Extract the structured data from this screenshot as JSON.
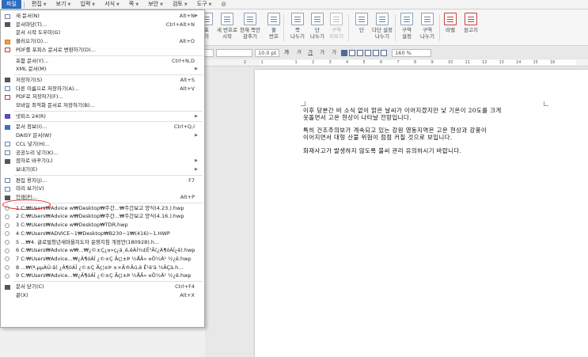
{
  "menubar": {
    "items": [
      {
        "label": "파일",
        "active": true,
        "arrow": false
      },
      {
        "label": "편집",
        "active": false,
        "arrow": true
      },
      {
        "label": "보기",
        "active": false,
        "arrow": true
      },
      {
        "label": "입력",
        "active": false,
        "arrow": true
      },
      {
        "label": "서식",
        "active": false,
        "arrow": true
      },
      {
        "label": "쪽",
        "active": false,
        "arrow": true
      },
      {
        "label": "보안",
        "active": false,
        "arrow": true
      },
      {
        "label": "검토",
        "active": false,
        "arrow": true
      },
      {
        "label": "도구",
        "active": false,
        "arrow": true
      }
    ]
  },
  "ribbon": {
    "buttons": [
      {
        "l1": "포",
        "l2": "기",
        "icon": "border-icon"
      },
      {
        "l1": "새 번호로",
        "l2": "시작",
        "icon": "page-number-new-icon"
      },
      {
        "l1": "현재 쪽만",
        "l2": "감추기",
        "icon": "hide-current-page-icon"
      },
      {
        "l1": "줄",
        "l2": "번호",
        "icon": "line-number-icon"
      },
      {
        "l1": "쪽",
        "l2": "나누기",
        "icon": "page-break-icon"
      },
      {
        "l1": "단",
        "l2": "나누기",
        "icon": "column-break-icon"
      },
      {
        "l1": "구역",
        "l2": "지우기",
        "icon": "delete-section-icon",
        "disabled": true
      },
      {
        "l1": "단",
        "l2": "",
        "icon": "columns-icon"
      },
      {
        "l1": "다단 설정",
        "l2": "나누기",
        "icon": "multi-column-icon"
      },
      {
        "l1": "구역",
        "l2": "설정",
        "icon": "section-settings-icon"
      },
      {
        "l1": "구역",
        "l2": "나누기",
        "icon": "section-break-icon"
      },
      {
        "l1": "라벨",
        "l2": "",
        "icon": "label-icon"
      },
      {
        "l1": "원고지",
        "l2": "",
        "icon": "manuscript-paper-icon"
      }
    ]
  },
  "format": {
    "font_size": "10.0",
    "unit": "pt",
    "zoom": "160",
    "zoom_unit": "%"
  },
  "ruler": {
    "ticks": [
      "2",
      "1",
      "",
      "1",
      "2",
      "3",
      "4",
      "5",
      "6",
      "7",
      "8",
      "9",
      "10",
      "11",
      "12",
      "13",
      "14",
      "15",
      "16"
    ]
  },
  "document": {
    "paragraphs": [
      "이후 당분간 비 소식 없이 맑은 날씨가 이어지겠지만 낮 기온이 20도를 크게\n웃돌면서 고온 현상이 나타날 전망입니다.",
      "특히 건조주의보가 계속되고 있는 강원 영동지역은 고온 현상과 강풍이\n이어지면서 대형 산불 위험이 점점 커질 것으로 보입니다.",
      "화재사고가 발생하지 않도록 불씨 관리 유의하시기 바랍니다."
    ]
  },
  "file_menu": {
    "items": [
      {
        "label": "새 문서(N)",
        "shortcut": "Alt+N",
        "submenu": true,
        "icon": "new-doc-icon",
        "icon_class": ""
      },
      {
        "label": "문서마당(T)...",
        "shortcut": "Ctrl+Alt+N",
        "submenu": false,
        "icon": "template-icon",
        "icon_class": "dark"
      },
      {
        "label": "문서 시작 도우미(G)",
        "shortcut": "",
        "submenu": false,
        "icon": "",
        "icon_class": "none"
      },
      {
        "label": "불러오기(O)...",
        "shortcut": "Alt+O",
        "submenu": false,
        "icon": "open-folder-icon",
        "icon_class": "orange"
      },
      {
        "label": "PDF를 포피스 문서로 변환하기(D)...",
        "shortcut": "",
        "submenu": false,
        "icon": "pdf-convert-icon",
        "icon_class": "red"
      },
      {
        "sep": true
      },
      {
        "label": "포함 문서(Y)...",
        "shortcut": "Ctrl+N,D",
        "submenu": false,
        "icon": "",
        "icon_class": "none"
      },
      {
        "label": "XML 문서(M)",
        "shortcut": "",
        "submenu": true,
        "icon": "",
        "icon_class": "none"
      },
      {
        "sep": true
      },
      {
        "label": "저장하기(S)",
        "shortcut": "Alt+S",
        "submenu": false,
        "icon": "save-icon",
        "icon_class": "dark"
      },
      {
        "label": "다른 이름으로 저장하기(A)...",
        "shortcut": "Alt+V",
        "submenu": false,
        "icon": "save-as-icon",
        "icon_class": ""
      },
      {
        "label": "PDF로 저장하기(F)...",
        "shortcut": "",
        "submenu": false,
        "icon": "pdf-save-icon",
        "icon_class": "red"
      },
      {
        "label": "모바일 최적화 문서로 저장하기(B)...",
        "shortcut": "",
        "submenu": false,
        "icon": "",
        "icon_class": "none"
      },
      {
        "sep": true
      },
      {
        "label": "넷피스 24(R)",
        "shortcut": "",
        "submenu": true,
        "icon": "netffice-icon",
        "icon_class": "purple"
      },
      {
        "sep": true
      },
      {
        "label": "문서 정보(I)...",
        "shortcut": "Ctrl+Q,I",
        "submenu": false,
        "icon": "doc-info-icon",
        "icon_class": "blue"
      },
      {
        "label": "DAISY 문서(W)",
        "shortcut": "",
        "submenu": true,
        "icon": "",
        "icon_class": "none"
      },
      {
        "label": "CCL 넣기(H)...",
        "shortcut": "",
        "submenu": false,
        "icon": "ccl-icon",
        "icon_class": ""
      },
      {
        "label": "공공누리 넣기(K)...",
        "shortcut": "",
        "submenu": false,
        "icon": "kogl-icon",
        "icon_class": ""
      },
      {
        "label": "점자로 바꾸기(L)",
        "shortcut": "",
        "submenu": true,
        "icon": "braille-icon",
        "icon_class": "dark"
      },
      {
        "label": "보내기(E)",
        "shortcut": "",
        "submenu": true,
        "icon": "",
        "icon_class": "none"
      },
      {
        "sep": true
      },
      {
        "label": "편집 용지(J)...",
        "shortcut": "F7",
        "submenu": false,
        "icon": "page-setup-icon",
        "icon_class": ""
      },
      {
        "label": "미리 보기(V)",
        "shortcut": "",
        "submenu": false,
        "icon": "print-preview-icon",
        "icon_class": ""
      },
      {
        "label": "인쇄(P)...",
        "shortcut": "Alt+P",
        "submenu": false,
        "icon": "print-icon",
        "icon_class": "dark"
      },
      {
        "sep": true
      },
      {
        "label": "1 C:₩Users₩Advice w₩Desktop₩주간...₩주간보고 양식(4.23.).hwp",
        "shortcut": "",
        "submenu": false,
        "icon": "pin-icon",
        "icon_class": "circ"
      },
      {
        "label": "2 C:₩Users₩Advice w₩Desktop₩주간...₩주간보고 양식(4.16.).hwp",
        "shortcut": "",
        "submenu": false,
        "icon": "pin-icon",
        "icon_class": "circ"
      },
      {
        "label": "3 C:₩Users₩Advice w₩Desktop₩TDR.hwp",
        "shortcut": "",
        "submenu": false,
        "icon": "pin-icon",
        "icon_class": "circ"
      },
      {
        "label": "4 C:₩Users₩ADVICE~1₩Desktop₩B230~1₩(416)~1.HWP",
        "shortcut": "",
        "submenu": false,
        "icon": "pin-icon",
        "icon_class": "circ"
      },
      {
        "label": "5 ...₩4. 글로벌청년새마을지도자 운영지침 개정안(180928).h...",
        "shortcut": "",
        "submenu": false,
        "icon": "pin-icon",
        "icon_class": "circ"
      },
      {
        "label": "6 C:₩Users₩Advice w₩...₩¿©±Ç¿¤»ç¿ä¸ê,ëÀÌ¾£Ê¹Ã(¿À¶óÀÎ¿ë).hwp",
        "shortcut": "",
        "submenu": false,
        "icon": "pin-icon",
        "icon_class": "circ"
      },
      {
        "label": "7 C:₩Users₩Advice...₩¿Â¶óÀÎ ¿©±Ç Ãç¦±Þ ½ÅÃ» ¤Ö½Ä¹ ½¿ë.hwp",
        "shortcut": "",
        "submenu": false,
        "icon": "pin-icon",
        "icon_class": "circ"
      },
      {
        "label": "8 ...₩(ª,µµÀÚ-â) ¿Â¶óÀÎ ¿©±Ç Ãç¦±Þ ±×Ã®Ãú,ë Ê¹ë'ä ½ÃÇà.h...",
        "shortcut": "",
        "submenu": false,
        "icon": "pin-icon",
        "icon_class": "circ"
      },
      {
        "label": "9 C:₩Users₩Advice...₩¿Â¶óÀÎ ¿©±Ç Ãç¦±Þ ½ÅÃ» ¤Ö½Ä¹ ½¿ë.hwp",
        "shortcut": "",
        "submenu": false,
        "icon": "pin-icon",
        "icon_class": "circ"
      },
      {
        "sep": true
      },
      {
        "label": "문서 닫기(C)",
        "shortcut": "Ctrl+F4",
        "submenu": false,
        "icon": "close-doc-icon",
        "icon_class": "dark"
      },
      {
        "label": "끝(X)",
        "shortcut": "Alt+X",
        "submenu": false,
        "icon": "",
        "icon_class": "none"
      }
    ]
  }
}
